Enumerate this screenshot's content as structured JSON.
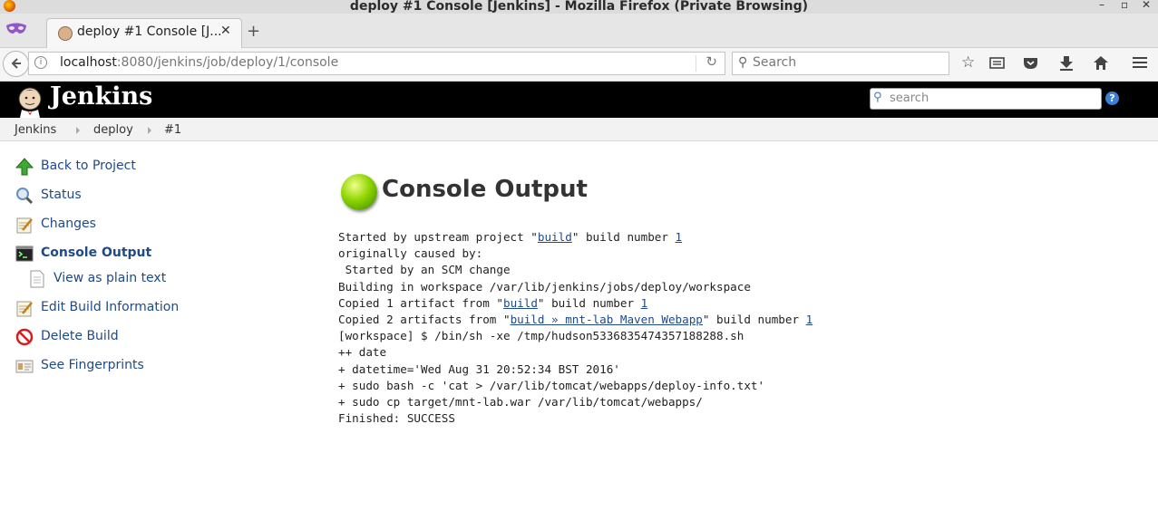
{
  "window": {
    "title": "deploy #1 Console [Jenkins] - Mozilla Firefox (Private Browsing)",
    "controls": [
      "–",
      "▫",
      "✕"
    ]
  },
  "tab": {
    "label": "deploy #1 Console [J...",
    "close": "✕",
    "new_tab": "+"
  },
  "urlbar": {
    "host": "localhost",
    "rest": ":8080/jenkins/job/deploy/1/console"
  },
  "search": {
    "placeholder": "Search"
  },
  "jenkins": {
    "name": "Jenkins",
    "search_placeholder": "search",
    "help": "?"
  },
  "breadcrumb": [
    "Jenkins",
    "deploy",
    "#1"
  ],
  "sidebar": {
    "items": [
      {
        "label": "Back to Project",
        "icon": "up-arrow-icon"
      },
      {
        "label": "Status",
        "icon": "magnifier-icon"
      },
      {
        "label": "Changes",
        "icon": "notepad-icon"
      },
      {
        "label": "Console Output",
        "icon": "terminal-icon"
      },
      {
        "label": "View as plain text",
        "icon": "document-icon"
      },
      {
        "label": "Edit Build Information",
        "icon": "notepad-edit-icon"
      },
      {
        "label": "Delete Build",
        "icon": "no-entry-icon"
      },
      {
        "label": "See Fingerprints",
        "icon": "fingerprint-card-icon"
      }
    ]
  },
  "main": {
    "title": "Console Output",
    "status": "success",
    "console": {
      "l1_a": "Started by upstream project \"",
      "l1_link": "build",
      "l1_b": "\" build number ",
      "l1_num": "1",
      "l2": "originally caused by:",
      "l3": " Started by an SCM change",
      "l4": "Building in workspace /var/lib/jenkins/jobs/deploy/workspace",
      "l5_a": "Copied 1 artifact from \"",
      "l5_link": "build",
      "l5_b": "\" build number ",
      "l5_num": "1",
      "l6_a": "Copied 2 artifacts from \"",
      "l6_link": "build » mnt-lab Maven Webapp",
      "l6_b": "\" build number ",
      "l6_num": "1",
      "l7": "[workspace] $ /bin/sh -xe /tmp/hudson5336835474357188288.sh",
      "l8": "++ date",
      "l9": "+ datetime='Wed Aug 31 20:52:34 BST 2016'",
      "l10": "+ sudo bash -c 'cat > /var/lib/tomcat/webapps/deploy-info.txt'",
      "l11": "+ sudo cp target/mnt-lab.war /var/lib/tomcat/webapps/",
      "l12": "Finished: SUCCESS"
    }
  }
}
